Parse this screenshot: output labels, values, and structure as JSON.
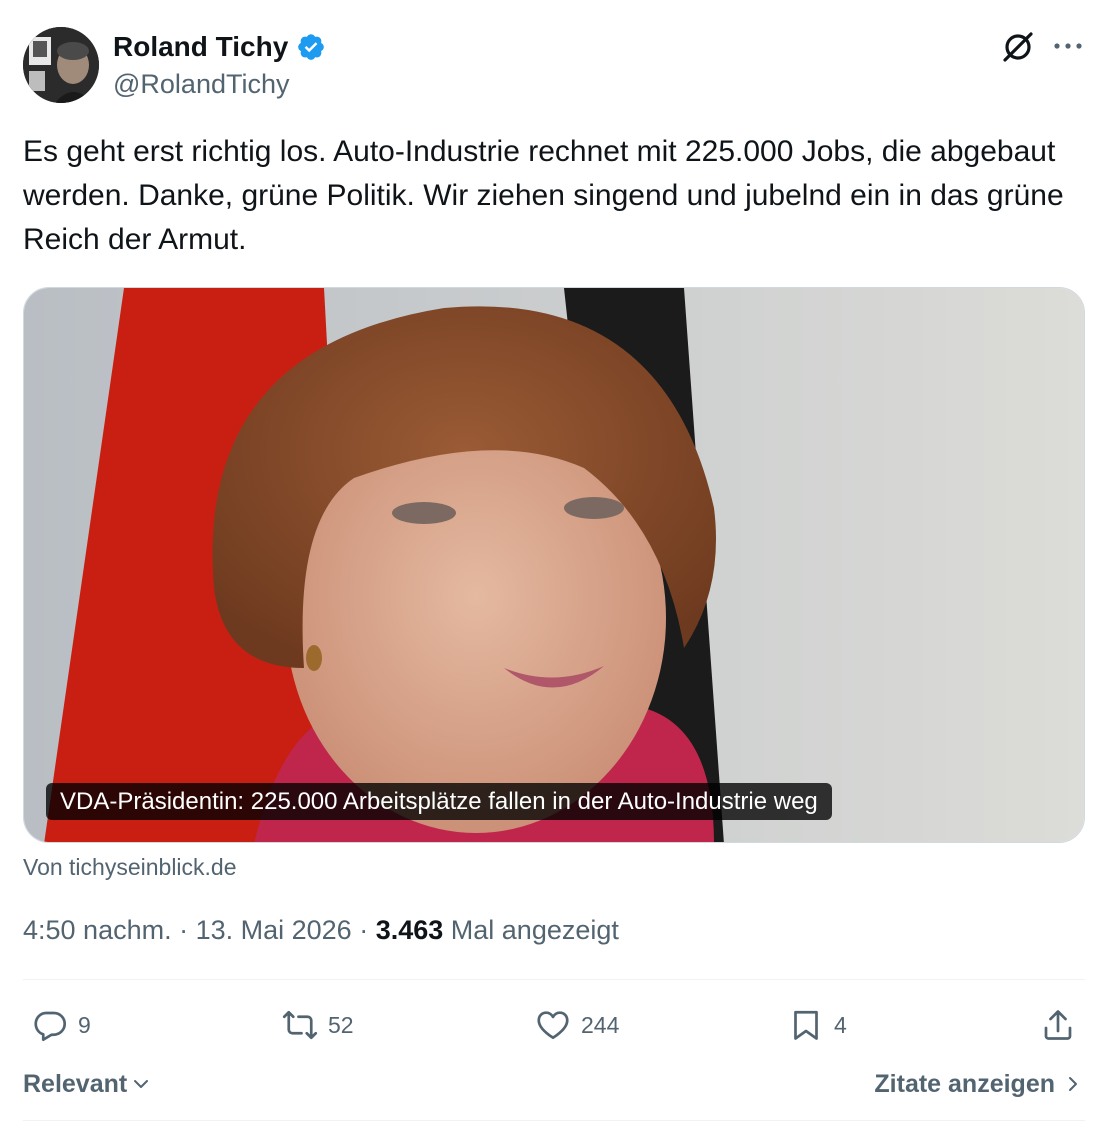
{
  "author": {
    "display_name": "Roland Tichy",
    "handle": "@RolandTichy",
    "verified_color": "#1d9bf0"
  },
  "tweet": {
    "text": "Es geht erst richtig los. Auto-Industrie rechnet mit 225.000 Jobs, die abgebaut werden. Danke, grüne Politik. Wir ziehen singend und jubelnd ein in das grüne Reich der Armut."
  },
  "media": {
    "caption": "VDA-Präsidentin: 225.000 Arbeitsplätze fallen in der Auto-Industrie weg",
    "source": "Von tichyseinblick.de"
  },
  "meta": {
    "time": "4:50 nachm.",
    "separator": " · ",
    "date": "13. Mai 2026",
    "views_count": "3.463",
    "views_label": " Mal angezeigt"
  },
  "actions": {
    "replies": "9",
    "reposts": "52",
    "likes": "244",
    "bookmarks": "4"
  },
  "footer": {
    "sort_label": "Relevant",
    "quotes_label": "Zitate anzeigen"
  },
  "icons": [
    "verified-icon",
    "grok-icon",
    "more-icon",
    "reply-icon",
    "repost-icon",
    "like-icon",
    "bookmark-icon",
    "share-icon",
    "chevron-down-icon",
    "chevron-right-icon"
  ]
}
